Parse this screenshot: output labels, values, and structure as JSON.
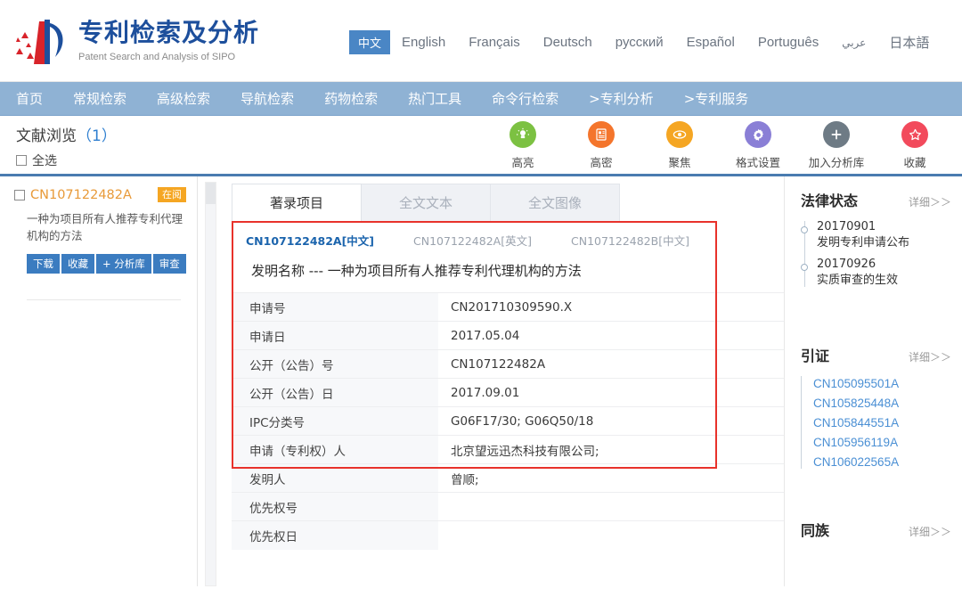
{
  "header": {
    "site_title": "专利检索及分析",
    "site_subtitle": "Patent Search and Analysis of SIPO",
    "logo_icon": "sipo-logo-icon",
    "languages": [
      {
        "label": "中文",
        "active": true
      },
      {
        "label": "English",
        "active": false
      },
      {
        "label": "Français",
        "active": false
      },
      {
        "label": "Deutsch",
        "active": false
      },
      {
        "label": "русский",
        "active": false
      },
      {
        "label": "Español",
        "active": false
      },
      {
        "label": "Português",
        "active": false
      },
      {
        "label": "عربي",
        "active": false
      },
      {
        "label": "日本語",
        "active": false
      }
    ]
  },
  "nav": {
    "items": [
      {
        "label": "首页"
      },
      {
        "label": "常规检索"
      },
      {
        "label": "高级检索"
      },
      {
        "label": "导航检索"
      },
      {
        "label": "药物检索"
      },
      {
        "label": "热门工具"
      },
      {
        "label": "命令行检索"
      },
      {
        "label": ">专利分析"
      },
      {
        "label": ">专利服务"
      }
    ]
  },
  "subbar": {
    "browse_label": "文献浏览",
    "browse_count": "（1）",
    "select_all_label": "全选",
    "tools": [
      {
        "label": "高亮",
        "icon": "lightbulb-icon",
        "color": "#7cc142",
        "glyph": "highlight"
      },
      {
        "label": "高密",
        "icon": "document-dense-icon",
        "color": "#f4752c",
        "glyph": "doc"
      },
      {
        "label": "聚焦",
        "icon": "eye-icon",
        "color": "#f5a623",
        "glyph": "eye"
      },
      {
        "label": "格式设置",
        "icon": "gear-icon",
        "color": "#8a7fd6",
        "glyph": "gear"
      },
      {
        "label": "加入分析库",
        "icon": "plus-icon",
        "color": "#6e7b85",
        "glyph": "plus"
      },
      {
        "label": "收藏",
        "icon": "star-icon",
        "color": "#f24a5c",
        "glyph": "star"
      }
    ]
  },
  "doclist": {
    "item": {
      "checkbox_icon": "checkbox-icon",
      "id": "CN107122482A",
      "badge": "在阅",
      "title": "一种为项目所有人推荐专利代理机构的方法",
      "buttons": [
        {
          "label": "下载"
        },
        {
          "label": "收藏"
        },
        {
          "label": "+ 分析库"
        },
        {
          "label": "审查"
        }
      ]
    }
  },
  "main": {
    "tabs": [
      {
        "label": "著录项目",
        "active": true
      },
      {
        "label": "全文文本",
        "active": false
      },
      {
        "label": "全文图像",
        "active": false
      }
    ],
    "id_tabs": [
      {
        "label": "CN107122482A[中文]",
        "active": true
      },
      {
        "label": "CN107122482A[英文]",
        "active": false
      },
      {
        "label": "CN107122482B[中文]",
        "active": false
      }
    ],
    "invention_title": "发明名称 ---  一种为项目所有人推荐专利代理机构的方法",
    "table": {
      "rows": [
        {
          "key": "申请号",
          "value": "CN201710309590.X"
        },
        {
          "key": "申请日",
          "value": "2017.05.04"
        },
        {
          "key": "公开（公告）号",
          "value": "CN107122482A"
        },
        {
          "key": "公开（公告）日",
          "value": "2017.09.01"
        },
        {
          "key": "IPC分类号",
          "value": "G06F17/30; G06Q50/18"
        },
        {
          "key": "申请（专利权）人",
          "value": "北京望远迅杰科技有限公司;"
        },
        {
          "key": "发明人",
          "value": "曾顺;"
        },
        {
          "key": "优先权号",
          "value": ""
        },
        {
          "key": "优先权日",
          "value": ""
        }
      ]
    }
  },
  "rail": {
    "legal_status": {
      "title": "法律状态",
      "more": "详细＞＞",
      "events": [
        {
          "date": "20170901",
          "desc": "发明专利申请公布"
        },
        {
          "date": "20170926",
          "desc": "实质审查的生效"
        }
      ]
    },
    "citations": {
      "title": "引证",
      "more": "详细＞＞",
      "items": [
        "CN105095501A",
        "CN105825448A",
        "CN105844551A",
        "CN105956119A",
        "CN106022565A"
      ]
    },
    "family": {
      "title": "同族",
      "more": "详细＞＞"
    }
  }
}
